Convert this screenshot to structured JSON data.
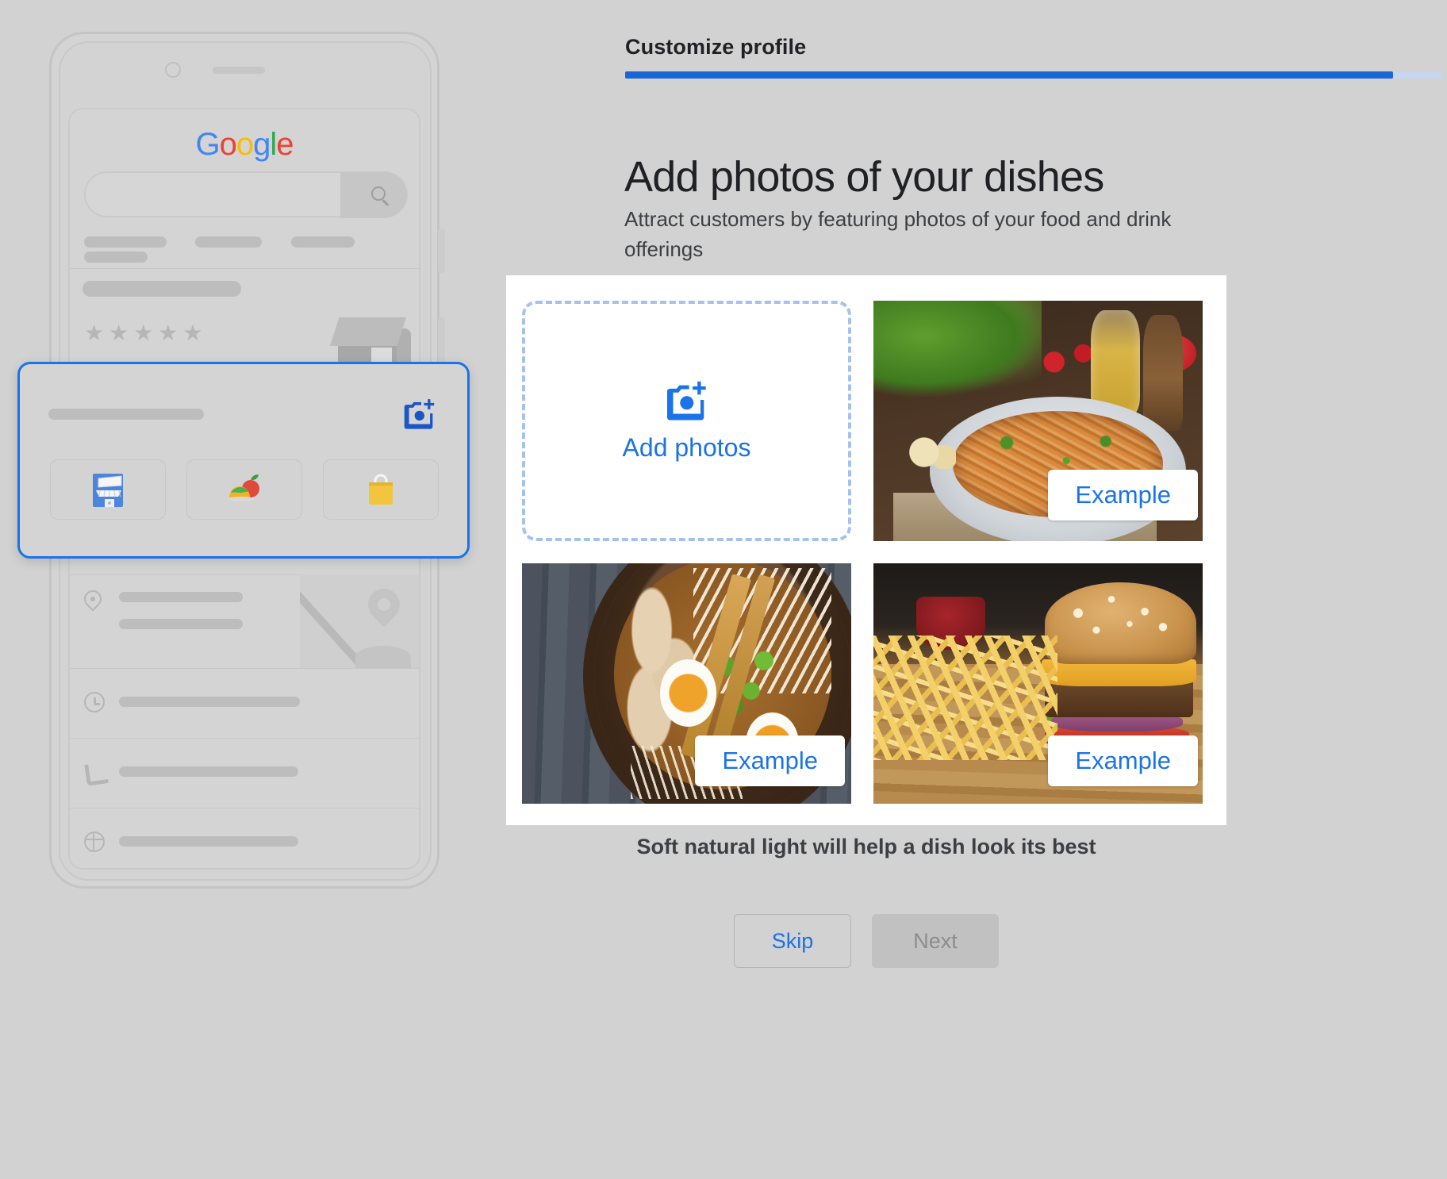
{
  "step": {
    "label": "Customize profile",
    "progress_percent": 94,
    "accent_color": "#1967d2"
  },
  "heading": {
    "title": "Add photos of your dishes",
    "subtitle": "Attract customers by featuring photos of your food and drink offerings"
  },
  "dropzone": {
    "label": "Add photos",
    "icon": "add-a-photo-icon",
    "accent_color": "#1a73e8"
  },
  "photos": [
    {
      "id": "pasta",
      "badge": "Example",
      "alt": "Spaghetti with tomato sauce on a plate with basil, cherry tomatoes, olive oil and a pepper grinder"
    },
    {
      "id": "ramen",
      "badge": "Example",
      "alt": "Noodle soup bowl with chicken, soft boiled eggs, scallions and chopsticks on dark wood"
    },
    {
      "id": "burger",
      "badge": "Example",
      "alt": "Cheeseburger with french fries and ketchup on a wooden board"
    }
  ],
  "hint": "Soft natural light will help a dish look its best",
  "actions": {
    "skip_label": "Skip",
    "next_label": "Next",
    "next_disabled": true
  },
  "phone_preview": {
    "brand": {
      "g1": "G",
      "o1": "o",
      "o2": "o",
      "g2": "g",
      "l": "l",
      "e": "e"
    },
    "search_icon": "search-icon",
    "storefront_icon": "storefront-icon",
    "rating_stars": "★★★★★",
    "rows": [
      {
        "icon": "location-pin-icon"
      },
      {
        "icon": "clock-icon"
      },
      {
        "icon": "phone-icon"
      },
      {
        "icon": "globe-icon"
      }
    ],
    "callout": {
      "camera_icon": "add-a-photo-icon",
      "highlight_color": "#1a73e8",
      "tiles": [
        {
          "icon": "business-storefront-icon"
        },
        {
          "icon": "food-menu-icon"
        },
        {
          "icon": "shopping-bag-icon"
        }
      ]
    }
  }
}
